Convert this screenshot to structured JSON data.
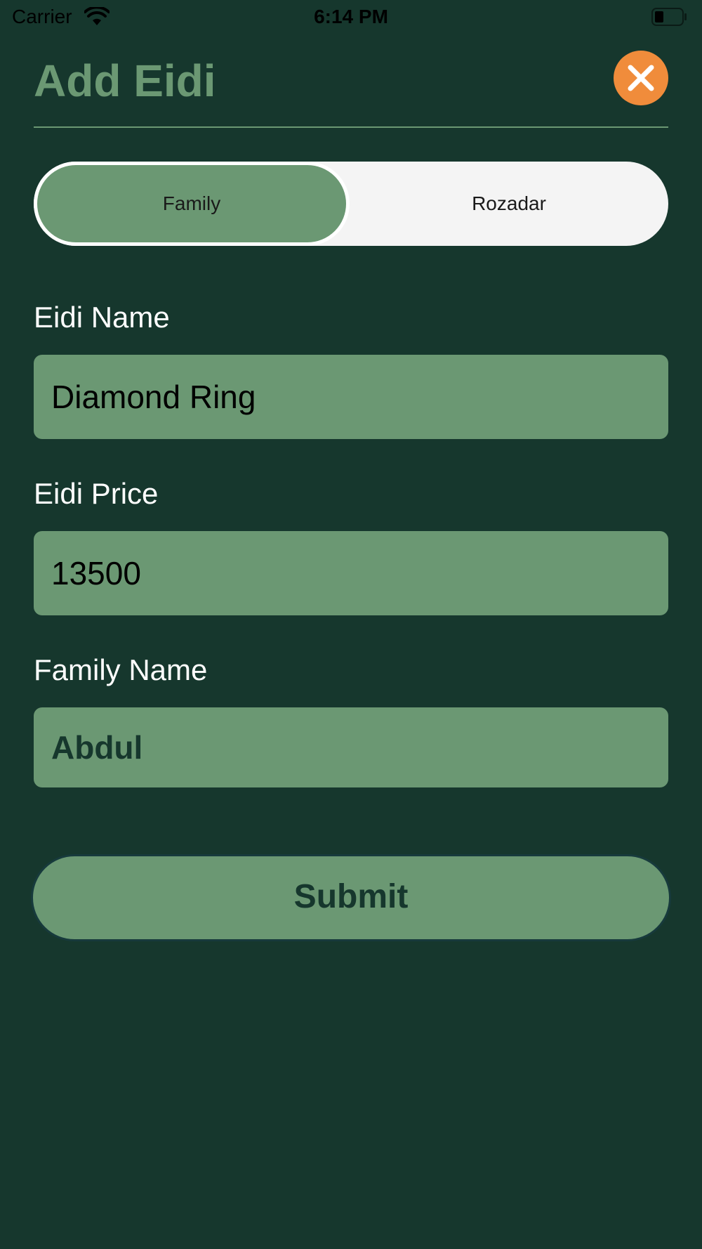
{
  "status_bar": {
    "carrier": "Carrier",
    "time": "6:14 PM",
    "wifi_icon": "wifi-icon",
    "battery_icon": "battery-icon"
  },
  "header": {
    "title": "Add Eidi",
    "close_icon": "close-icon"
  },
  "segments": {
    "items": [
      {
        "label": "Family",
        "selected": true
      },
      {
        "label": "Rozadar",
        "selected": false
      }
    ]
  },
  "form": {
    "eidi_name": {
      "label": "Eidi Name",
      "value": "Diamond Ring"
    },
    "eidi_price": {
      "label": "Eidi Price",
      "value": "13500"
    },
    "family_name": {
      "label": "Family Name",
      "value": "Abdul"
    }
  },
  "submit": {
    "label": "Submit"
  },
  "colors": {
    "background": "#16372d",
    "accent": "#6b9873",
    "close_button": "#f08c3b",
    "segment_track": "#f4f4f4"
  }
}
